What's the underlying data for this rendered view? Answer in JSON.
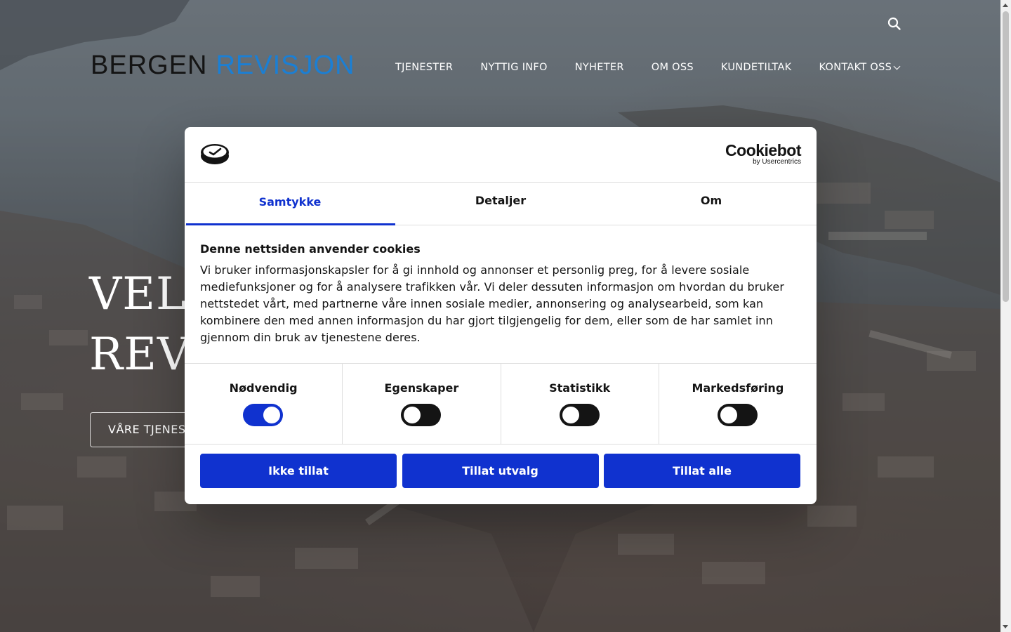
{
  "header": {
    "logo": {
      "part1": "BERGEN",
      "part2": "REVISJON"
    },
    "nav": [
      {
        "label": "TJENESTER"
      },
      {
        "label": "NYTTIG INFO"
      },
      {
        "label": "NYHETER"
      },
      {
        "label": "OM OSS"
      },
      {
        "label": "KUNDETILTAK"
      },
      {
        "label": "KONTAKT OSS",
        "has_dropdown": true
      }
    ],
    "search_icon": "search-icon"
  },
  "hero": {
    "title_line1": "VELI",
    "title_line2": "REVI",
    "button_label": "VÅRE TJENES"
  },
  "cookie_dialog": {
    "brand": {
      "name": "Cookiebot",
      "sub": "by Usercentrics"
    },
    "tabs": [
      {
        "label": "Samtykke",
        "active": true
      },
      {
        "label": "Detaljer",
        "active": false
      },
      {
        "label": "Om",
        "active": false
      }
    ],
    "title": "Denne nettsiden anvender cookies",
    "text": "Vi bruker informasjonskapsler for å gi innhold og annonser et personlig preg, for å levere sosiale mediefunksjoner og for å analysere trafikken vår. Vi deler dessuten informasjon om hvordan du bruker nettstedet vårt, med partnerne våre innen sosiale medier, annonsering og analysearbeid, som kan kombinere den med annen informasjon du har gjort tilgjengelig for dem, eller som de har samlet inn gjennom din bruk av tjenestene deres.",
    "categories": [
      {
        "label": "Nødvendig",
        "enabled": true
      },
      {
        "label": "Egenskaper",
        "enabled": false
      },
      {
        "label": "Statistikk",
        "enabled": false
      },
      {
        "label": "Markedsføring",
        "enabled": false
      }
    ],
    "buttons": {
      "deny": "Ikke tillat",
      "allow_selection": "Tillat utvalg",
      "allow_all": "Tillat alle"
    }
  },
  "colors": {
    "accent": "#1032cf",
    "logo_blue": "#1b7fd4",
    "text": "#141414",
    "toggle_off": "#141414"
  }
}
